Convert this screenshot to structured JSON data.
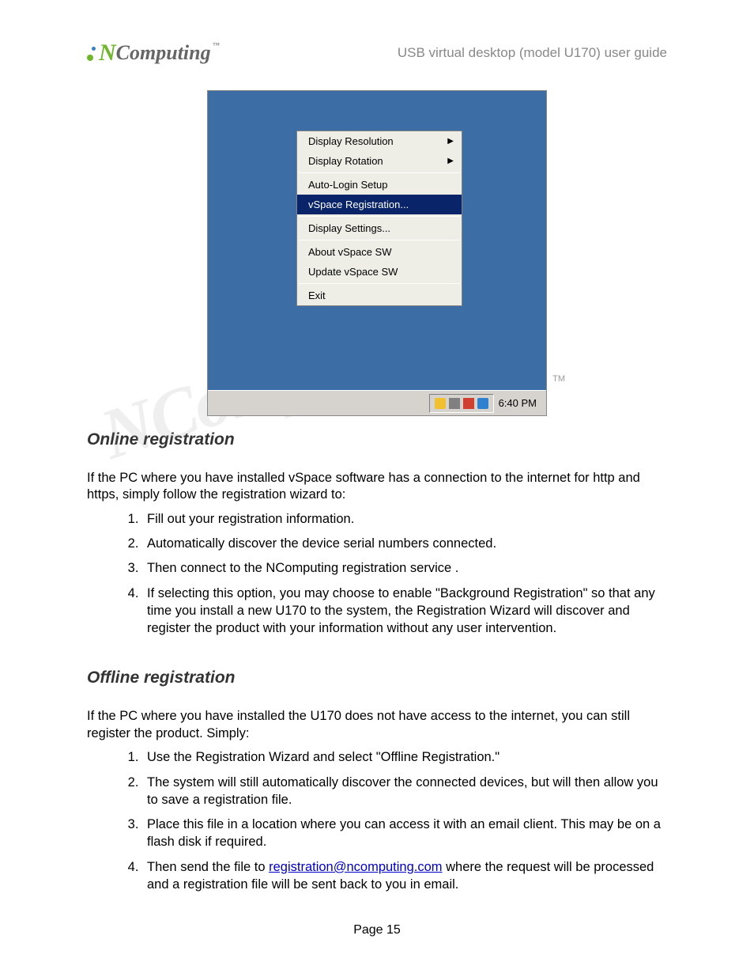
{
  "header": {
    "logo_text": "Computing",
    "logo_tm": "™",
    "doc_title": "USB virtual desktop (model U170) user guide"
  },
  "menu": {
    "items": [
      {
        "label": "Display Resolution",
        "submenu": true
      },
      {
        "label": "Display Rotation",
        "submenu": true
      }
    ],
    "items2": [
      {
        "label": "Auto-Login Setup"
      },
      {
        "label": "vSpace Registration...",
        "selected": true
      }
    ],
    "items3": [
      {
        "label": "Display Settings..."
      }
    ],
    "items4": [
      {
        "label": "About vSpace SW"
      },
      {
        "label": "Update vSpace SW"
      }
    ],
    "items5": [
      {
        "label": "Exit"
      }
    ]
  },
  "taskbar": {
    "clock": "6:40 PM",
    "tm": "TM"
  },
  "sections": {
    "online_title": "Online registration",
    "online_intro": "If the PC where you have installed vSpace software has a connection to the internet for http and https, simply follow the registration wizard to:",
    "online_steps": [
      "Fill out your registration information.",
      "Automatically discover the device serial numbers connected.",
      "Then connect to the NComputing registration service .",
      "If selecting this option, you may choose to enable \"Background Registration\" so that any time you install a new U170 to the system, the Registration Wizard will discover and register the product with your information without any user intervention."
    ],
    "offline_title": "Offline registration",
    "offline_intro": "If the PC where you have installed the U170 does not have access to the internet, you can still register the product. Simply:",
    "offline_steps": [
      "Use the Registration Wizard and select \"Offline Registration.\"",
      "The system will still automatically discover the connected devices, but will then allow you to save a registration file.",
      "Place this file in a location where you can access it with an email client. This may be on a flash disk if required.",
      {
        "pre": "Then send the file to ",
        "link": "registration@ncomputing.com",
        "post": " where the request will be processed and a registration file will be sent back to you in email."
      }
    ]
  },
  "footer": {
    "page": "Page 15"
  },
  "watermark": "NComputing"
}
